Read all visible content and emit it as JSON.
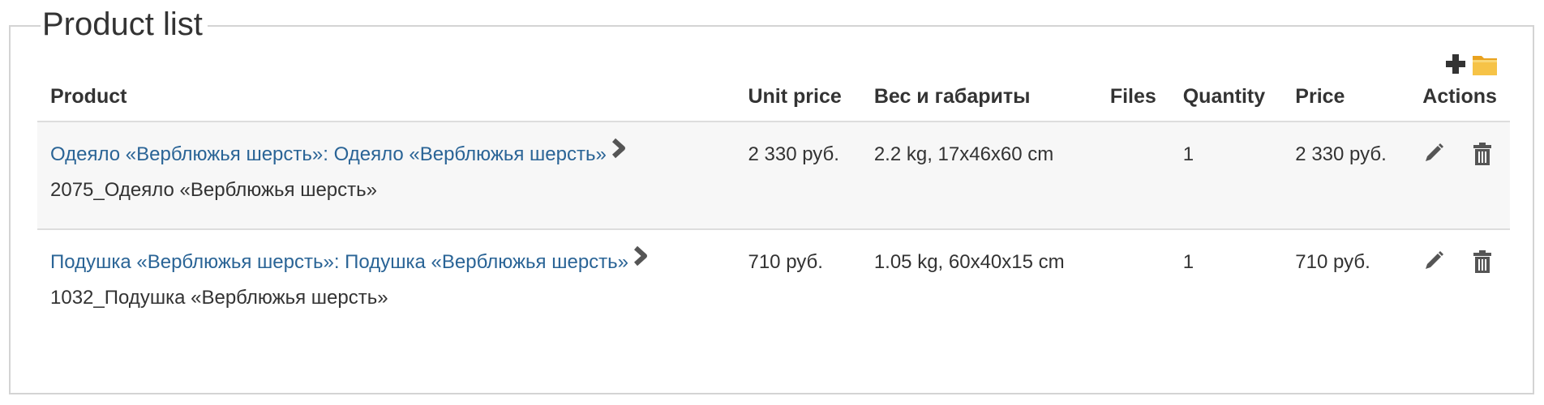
{
  "fieldset": {
    "legend": "Product list"
  },
  "toolbar": {
    "add_icon": "plus-icon",
    "folder_icon": "folder-icon"
  },
  "table": {
    "headers": [
      "Product",
      "Unit price",
      "Вес и габариты",
      "Files",
      "Quantity",
      "Price",
      "Actions"
    ],
    "rows": [
      {
        "product_link": "Одеяло «Верблюжья шерсть»: Одеяло «Верблюжья шерсть»",
        "sku": "2075_Одеяло «Верблюжья шерсть»",
        "unit_price": "2 330 руб.",
        "dims": "2.2 kg, 17x46x60 cm",
        "files": "",
        "quantity": "1",
        "price": "2 330 руб."
      },
      {
        "product_link": "Подушка «Верблюжья шерсть»: Подушка «Верблюжья шерсть»",
        "sku": "1032_Подушка «Верблюжья шерсть»",
        "unit_price": "710 руб.",
        "dims": "1.05 kg, 60x40x15 cm",
        "files": "",
        "quantity": "1",
        "price": "710 руб."
      }
    ]
  },
  "colors": {
    "link": "#2a6496",
    "text": "#333333",
    "row_alt": "#f7f7f7",
    "border": "#d4d4d4",
    "folder": "#f5b82e"
  }
}
